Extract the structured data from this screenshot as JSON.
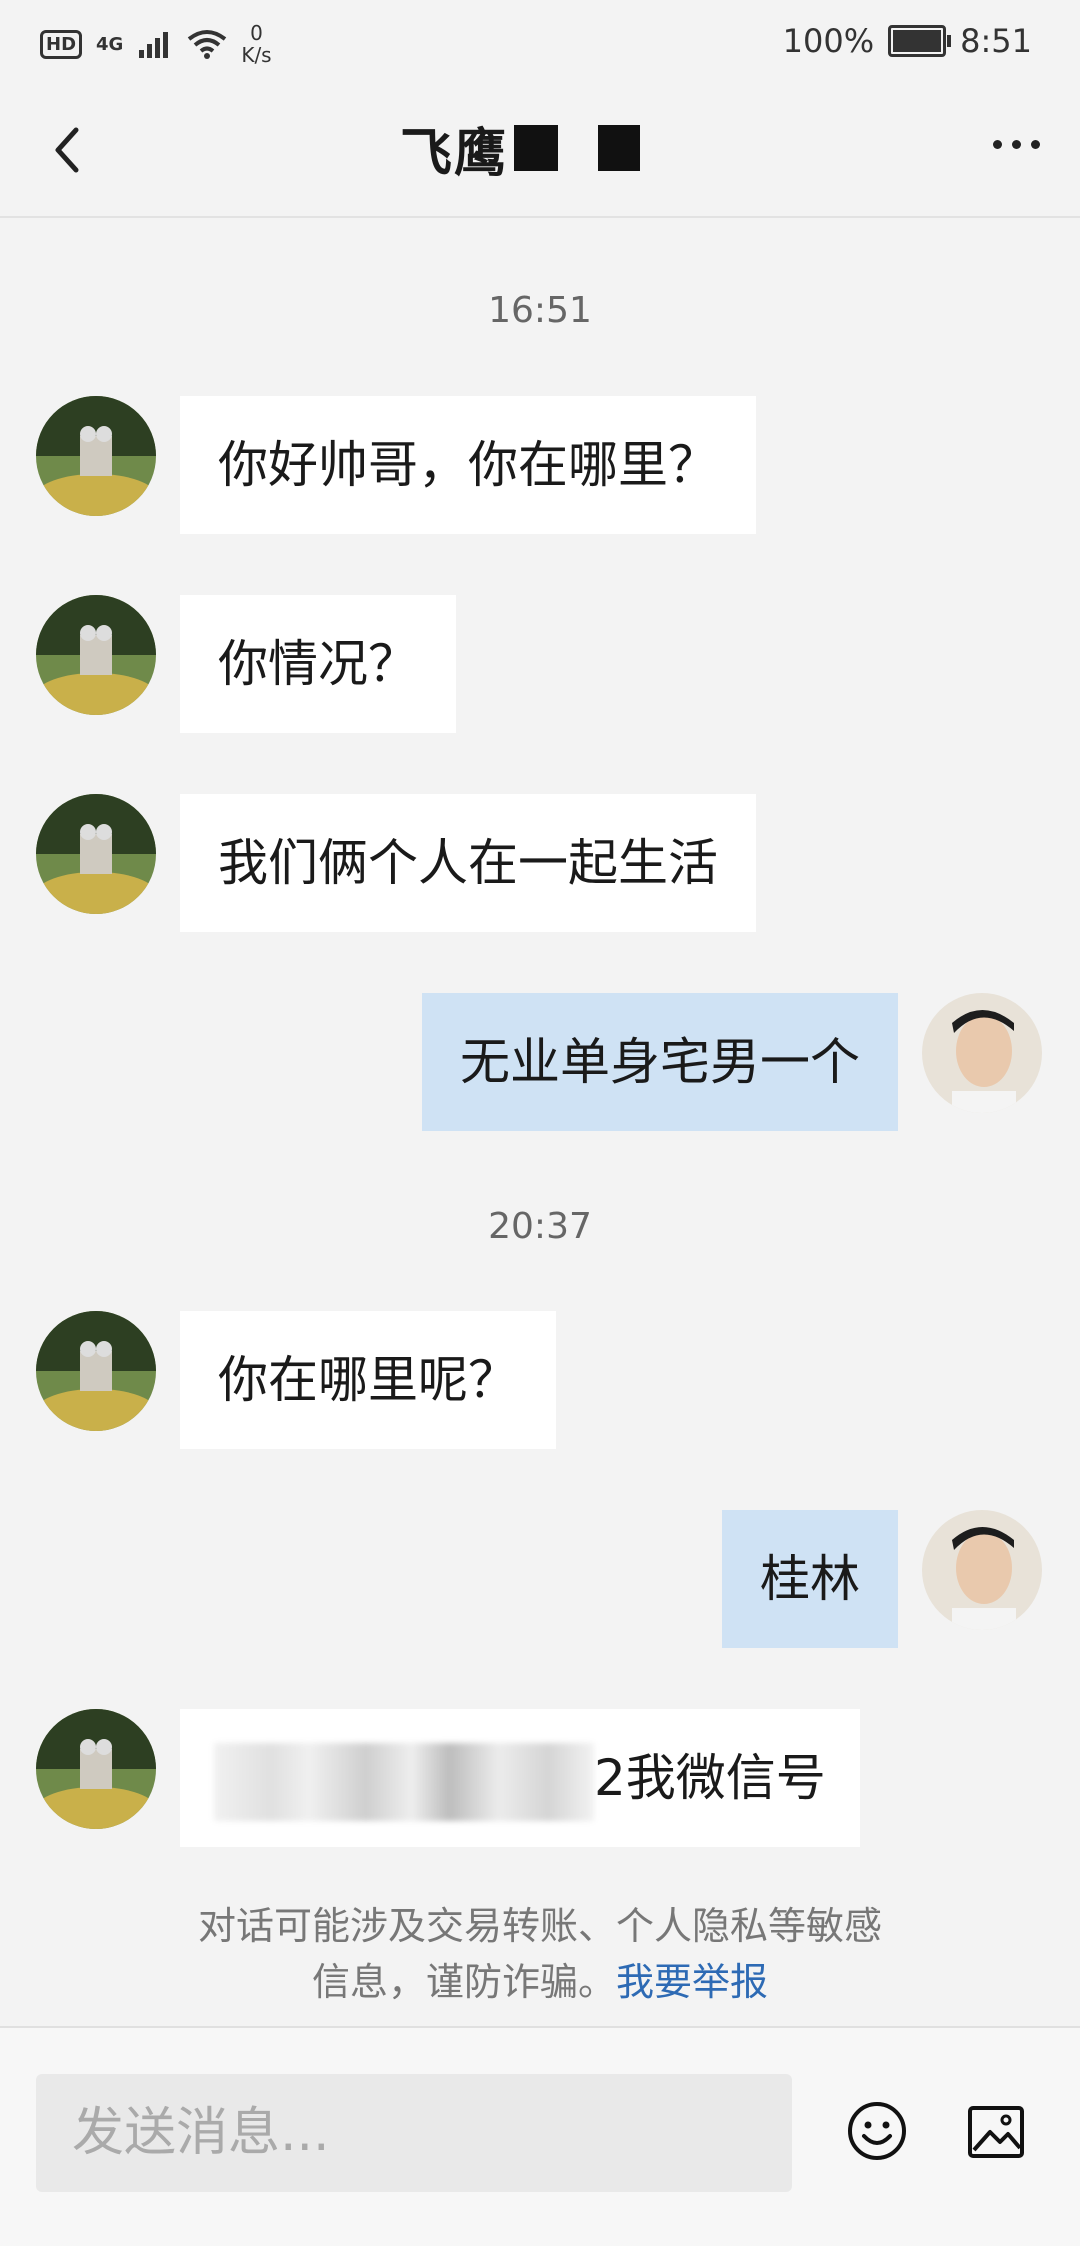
{
  "status_bar": {
    "hd": "HD",
    "network": "4G",
    "speed_value": "0",
    "speed_unit": "K/s",
    "battery_percent": "100%",
    "time": "8:51"
  },
  "header": {
    "title": "飞鹰",
    "back_icon": "chevron-left-icon",
    "more_icon": "more-dots-icon"
  },
  "timestamps": [
    "16:51",
    "20:37"
  ],
  "messages": [
    {
      "from": "other",
      "text": "你好帅哥，你在哪里？"
    },
    {
      "from": "other",
      "text": "你情况？"
    },
    {
      "from": "other",
      "text": "我们俩个人在一起生活"
    },
    {
      "from": "me",
      "text": "无业单身宅男一个"
    },
    {
      "from": "other",
      "text": "你在哪里呢？"
    },
    {
      "from": "me",
      "text": "桂林"
    },
    {
      "from": "other",
      "text": "2我微信号",
      "prefix_partial": "32"
    }
  ],
  "notice": {
    "line1": "对话可能涉及交易转账、个人隐私等敏感",
    "line2": "信息，谨防诈骗。",
    "link": "我要举报"
  },
  "footer": {
    "input_placeholder": "发送消息...",
    "emoji_icon": "emoji-icon",
    "image_icon": "image-icon"
  },
  "colors": {
    "background": "#f3f3f3",
    "other_bubble": "#ffffff",
    "me_bubble": "#cfe2f4",
    "link": "#2d6ab4"
  }
}
